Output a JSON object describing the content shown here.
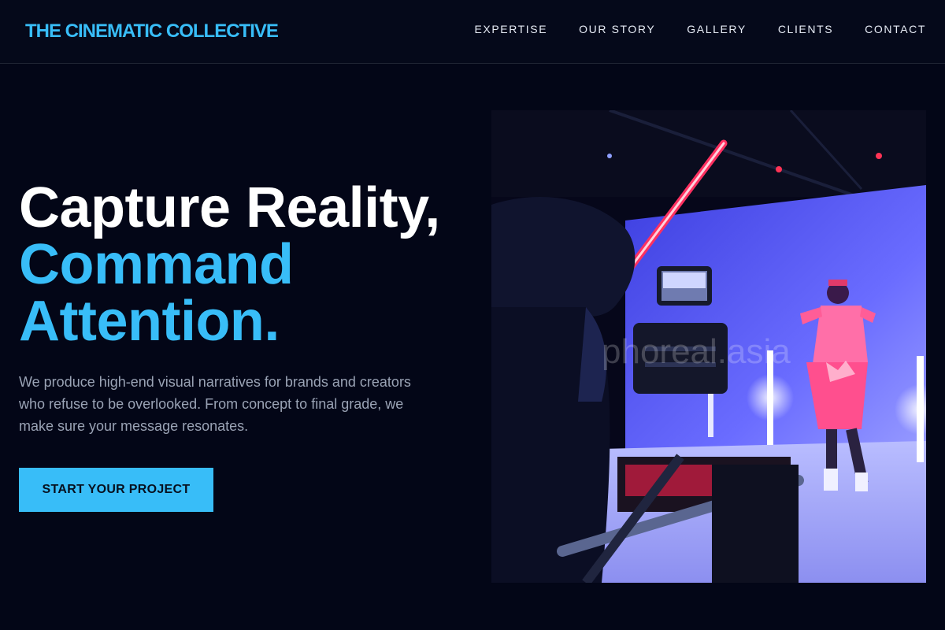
{
  "header": {
    "brand": "THE CINEMATIC COLLECTIVE",
    "nav": [
      "EXPERTISE",
      "OUR STORY",
      "GALLERY",
      "CLIENTS",
      "CONTACT"
    ]
  },
  "hero": {
    "headline_line1": "Capture Reality,",
    "headline_line2": "Command",
    "headline_line3": "Attention.",
    "description": "We produce high-end visual narratives for brands and creators who refuse to be overlooked. From concept to final grade, we make sure your message resonates.",
    "cta_label": "START YOUR PROJECT"
  },
  "image": {
    "watermark": "phoreal.asia",
    "subject": "camera operator filming a dancer in a blue-lit studio"
  },
  "colors": {
    "background": "#030617",
    "accent": "#38bdf8",
    "heading": "#ffffff",
    "body_text": "#9aa3b5"
  }
}
